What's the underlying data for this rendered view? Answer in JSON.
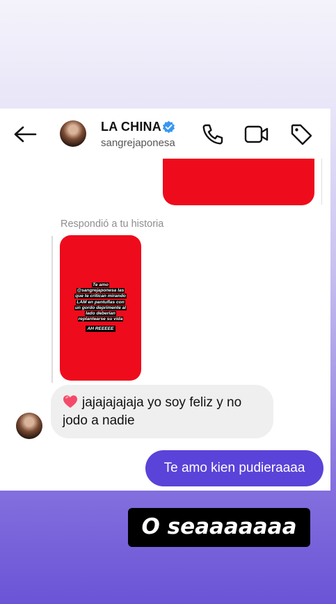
{
  "header": {
    "contact_name": "LA CHINA",
    "contact_handle": "sangrejaponesa",
    "verified": true,
    "icons": [
      "back-arrow-icon",
      "verified-icon",
      "phone-icon",
      "video-call-icon",
      "tag-icon"
    ]
  },
  "conversation": {
    "replied_label": "Respondió a tu historia",
    "story": {
      "lines": [
        "Te amo",
        "@sangrejaponesa las",
        "que te critican mirando",
        "LAM en pantuflas con",
        "un gordo deprimente al",
        "lado deberían",
        "replantearse su vida"
      ],
      "sticker": "AH REEEEE",
      "background_color": "#ee0b1c"
    },
    "incoming_message": "jajajajajaja yo soy feliz y no jodo a nadie",
    "outgoing_message": "Te amo kien pudieraaaa"
  },
  "overlay_caption": "O seaaaaaaa",
  "colors": {
    "outgoing_bubble": "#5a43d8",
    "incoming_bubble": "#efefef",
    "story_red": "#ee0b1c",
    "verified_blue": "#3897f0"
  }
}
